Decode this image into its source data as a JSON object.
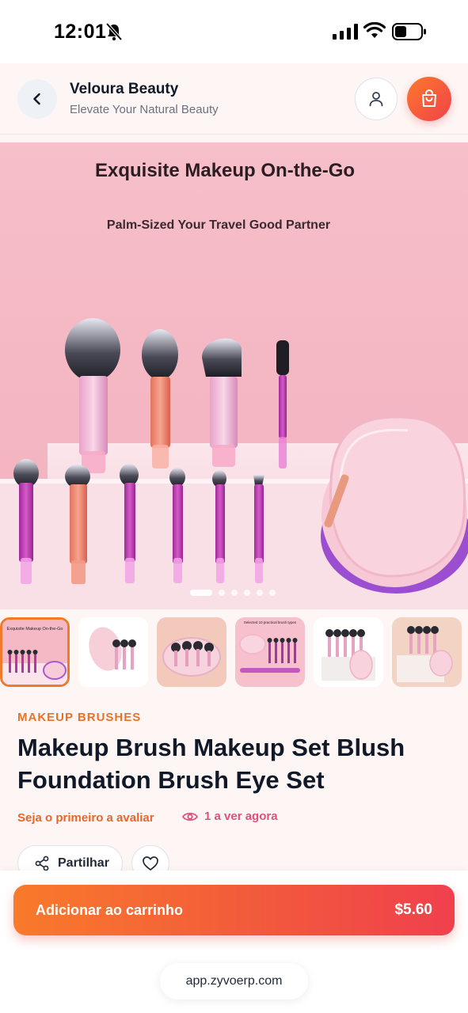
{
  "status_bar": {
    "time": "12:01"
  },
  "header": {
    "store_name": "Veloura Beauty",
    "tagline": "Elevate Your Natural Beauty"
  },
  "hero": {
    "title": "Exquisite Makeup On-the-Go",
    "subtitle": "Palm-Sized Your Travel Good Partner",
    "slide_count": 6,
    "active_slide": 1
  },
  "thumbnails": [
    {
      "caption": "Exquisite Makeup On-the-Go"
    },
    {
      "caption": ""
    },
    {
      "caption": ""
    },
    {
      "caption": "Selected 10 practical brush types"
    },
    {
      "caption": ""
    },
    {
      "caption": ""
    }
  ],
  "product": {
    "category": "MAKEUP BRUSHES",
    "title": "Makeup Brush Makeup Set Blush Foundation Brush Eye Set",
    "review_link": "Seja o primeiro a avaliar",
    "views_text": "1 a ver agora",
    "share_label": "Partilhar"
  },
  "cart": {
    "add_label": "Adicionar ao carrinho",
    "price": "$5.60"
  },
  "browser": {
    "url": "app.zyvoerp.com"
  },
  "colors": {
    "accent_orange": "#ea7228",
    "accent_red": "#f0404d",
    "views_pink": "#e0507a",
    "text_dark": "#111827"
  }
}
